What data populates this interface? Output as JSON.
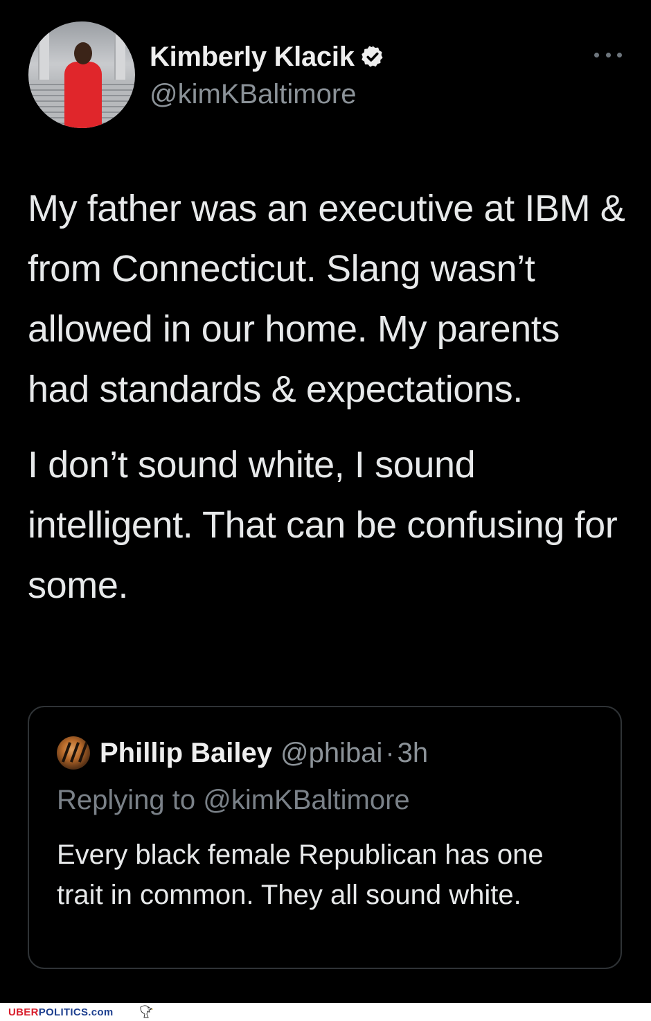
{
  "tweet": {
    "author": {
      "display_name": "Kimberly Klacik",
      "handle": "@kimKBaltimore",
      "verified_icon": "verified-badge-icon"
    },
    "more_icon": "more-dots-icon",
    "paragraphs": [
      "My father was an executive at IBM & from Connecticut. Slang wasn’t allowed in our home. My parents had standards & expectations.",
      "I don’t sound white, I sound intelligent. That can be confusing for some."
    ]
  },
  "quoted_tweet": {
    "display_name": "Phillip Bailey",
    "handle": "@phibai",
    "separator": "·",
    "time": "3h",
    "replying_to": "Replying to @kimKBaltimore",
    "text": "Every black female Republican has one trait in common. They all sound white."
  },
  "watermark": {
    "part1": "UBER",
    "part2": "POLITICS",
    "part3": ".com",
    "logo_icon": "eagle-icon"
  },
  "colors": {
    "background": "#000000",
    "text": "#e7e9ea",
    "secondary_text": "#8b9298",
    "border": "#2f3336",
    "brand_red": "#d81c2a",
    "brand_blue": "#1d3f8f"
  }
}
